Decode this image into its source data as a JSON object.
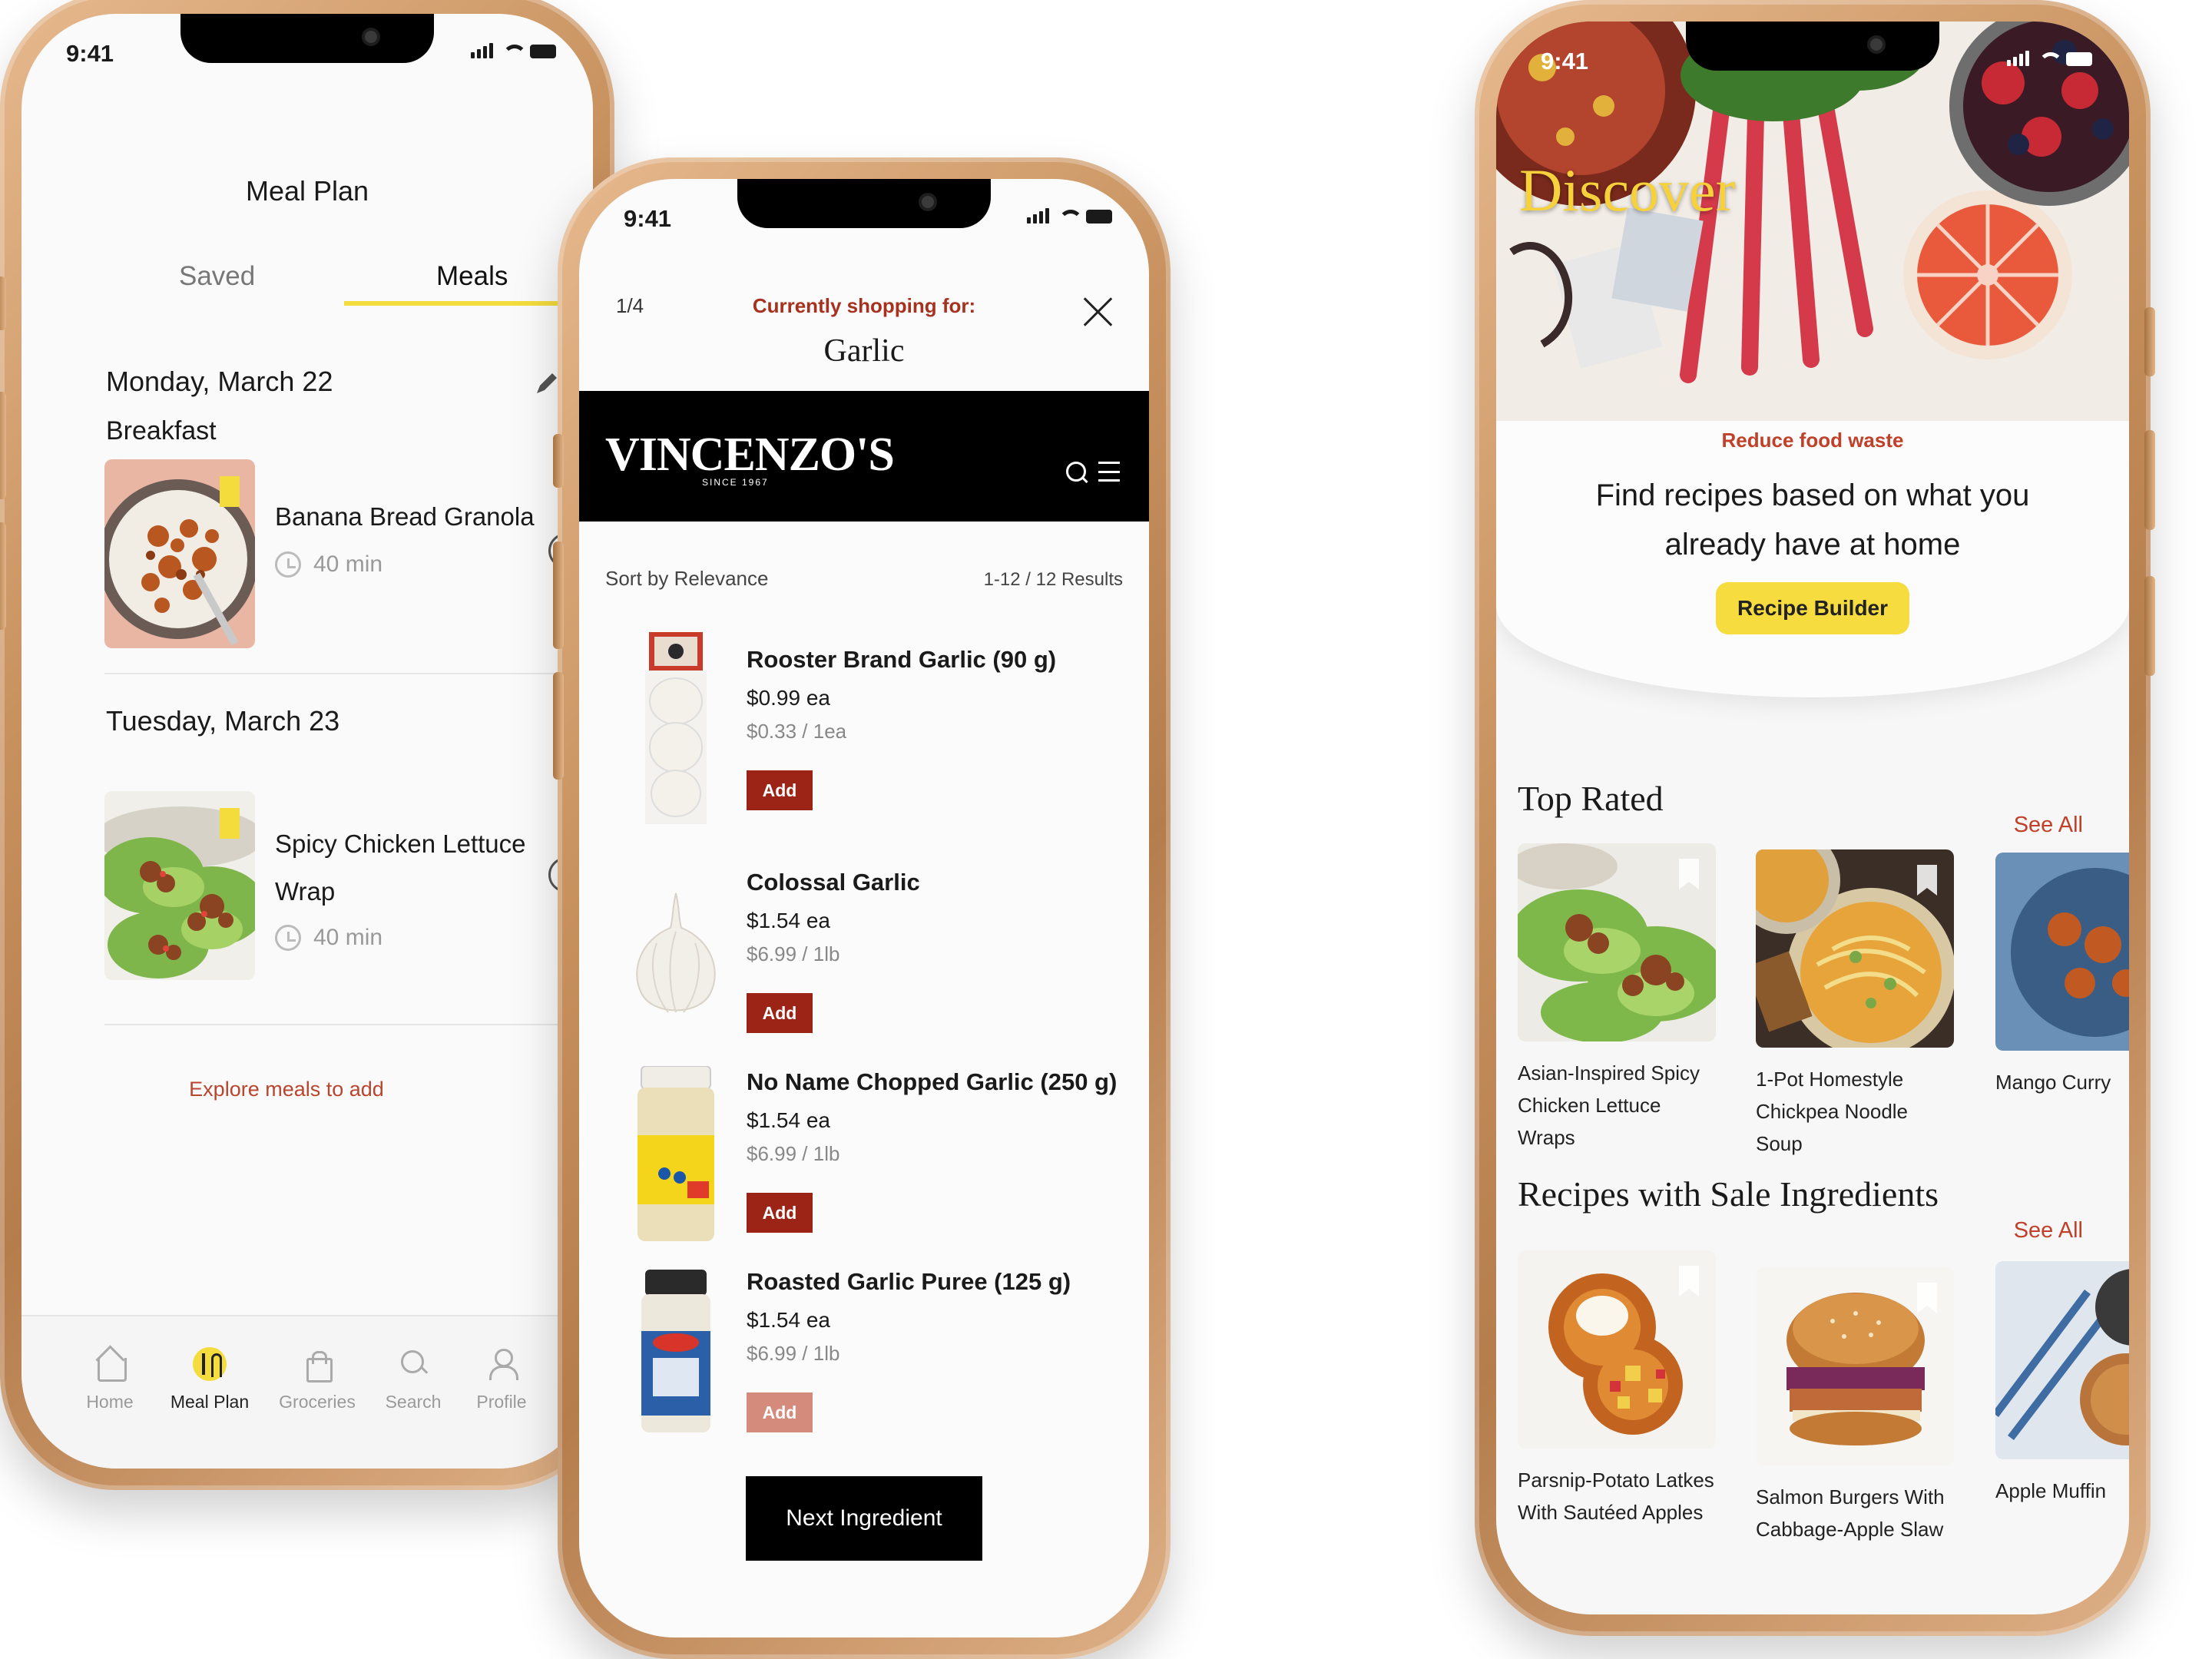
{
  "status": {
    "time": "9:41"
  },
  "meal_plan": {
    "title": "Meal Plan",
    "tabs": [
      {
        "label": "Saved"
      },
      {
        "label": "Meals"
      }
    ],
    "days": [
      {
        "date": "Monday, March 22",
        "meal_type": "Breakfast",
        "recipe": "Banana Bread Granola",
        "time": "40 min"
      },
      {
        "date": "Tuesday, March 23",
        "meal_type": "",
        "recipe": "Spicy Chicken Lettuce Wrap",
        "time": "40 min"
      }
    ],
    "explore_link": "Explore meals to add",
    "nav": [
      {
        "label": "Home",
        "icon": "home-icon"
      },
      {
        "label": "Meal Plan",
        "icon": "utensils-icon"
      },
      {
        "label": "Groceries",
        "icon": "shopping-bag-icon",
        "badge": "0"
      },
      {
        "label": "Search",
        "icon": "search-icon"
      },
      {
        "label": "Profile",
        "icon": "profile-icon"
      }
    ]
  },
  "shopping": {
    "counter": "1/4",
    "kicker": "Currently shopping for:",
    "ingredient": "Garlic",
    "store": {
      "name": "VINCENZO'S",
      "since": "SINCE 1967"
    },
    "sort": "Sort by Relevance",
    "results": "1-12 / 12 Results",
    "products": [
      {
        "name": "Rooster Brand Garlic (90 g)",
        "price": "$0.99 ea",
        "unit": "$0.33 / 1ea",
        "add": "Add"
      },
      {
        "name": "Colossal Garlic",
        "price": "$1.54 ea",
        "unit": "$6.99 / 1lb",
        "add": "Add"
      },
      {
        "name": "No Name Chopped Garlic (250 g)",
        "price": "$1.54 ea",
        "unit": "$6.99 / 1lb",
        "add": "Add"
      },
      {
        "name": "Roasted Garlic Puree (125 g)",
        "price": "$1.54 ea",
        "unit": "$6.99 / 1lb",
        "add": "Add"
      }
    ],
    "next_button": "Next Ingredient"
  },
  "discover": {
    "title": "Discover",
    "kicker": "Reduce food waste",
    "headline": "Find recipes based on what you already have at home",
    "cta": "Recipe Builder",
    "sections": [
      {
        "title": "Top Rated",
        "see_all": "See All",
        "recipes": [
          {
            "title": "Asian-Inspired Spicy Chicken Lettuce Wraps"
          },
          {
            "title": "1-Pot Homestyle Chickpea Noodle Soup"
          },
          {
            "title": "Mango Curry"
          }
        ]
      },
      {
        "title": "Recipes with Sale Ingredients",
        "see_all": "See All",
        "recipes": [
          {
            "title": "Parsnip-Potato Latkes With Sautéed Apples"
          },
          {
            "title": "Salmon Burgers With Cabbage-Apple Slaw"
          },
          {
            "title": "Apple Muffin"
          }
        ]
      }
    ]
  },
  "colors": {
    "accent_yellow": "#f4dc3c",
    "accent_red": "#b8452d",
    "store_red": "#9b2416",
    "frame_gold": "#c8925f"
  }
}
